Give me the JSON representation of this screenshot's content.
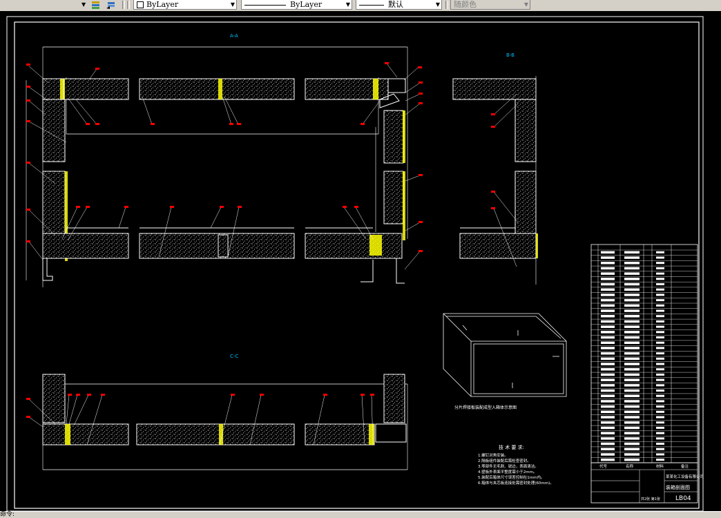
{
  "toolbar": {
    "lineweight_label": "ByLayer",
    "linetype_label": "ByLayer",
    "lineweight2_label": "默认",
    "plotstyle_label": "随颜色"
  },
  "drawing": {
    "section_aa": "A-A",
    "section_bb": "B-B",
    "section_cc": "C-C",
    "iso_caption": "分片焊接板装配成型入箱体示意图",
    "notes_title": "技 术 要 求:",
    "notes": [
      "1.螺钉对角安装。",
      "2.隔板组件装配后需检查密封。",
      "3.零部件无毛刺、锐边，表面清洁。",
      "4.壁板外表面平整度需小于2mm。",
      "5.装配后箱体尺寸误差控制在1mm内。",
      "6.箱体与夹芯板连接处需密封处理(60mm)。"
    ],
    "title_block": {
      "company": "某某化工设备有限公司",
      "drawing_name": "装箱剖面图",
      "drawing_no": "LB04",
      "sheet": "共2张  第1张",
      "col_code": "代号",
      "col_name": "名称",
      "col_material": "材料",
      "col_remark": "备注"
    }
  },
  "status": {
    "text": "命令:"
  },
  "colors": {
    "canvas": "#000000",
    "drawing_line": "#ffffff",
    "insulation": "#ffff00",
    "callout": "#ff0000",
    "section_label": "#00bfff",
    "ui_face": "#d4d0c8"
  }
}
